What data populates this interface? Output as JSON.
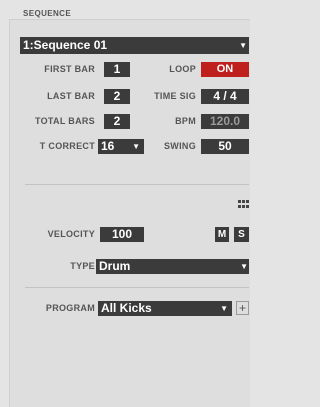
{
  "section": {
    "title": "SEQUENCE"
  },
  "sequence_select": {
    "value": "1:Sequence 01"
  },
  "fields": {
    "first_bar": {
      "label": "FIRST BAR",
      "value": "1"
    },
    "last_bar": {
      "label": "LAST BAR",
      "value": "2"
    },
    "total_bars": {
      "label": "TOTAL BARS",
      "value": "2"
    },
    "t_correct": {
      "label": "T CORRECT",
      "value": "16"
    },
    "loop": {
      "label": "LOOP",
      "value": "ON"
    },
    "time_sig": {
      "label": "TIME SIG",
      "value": "4 / 4"
    },
    "bpm": {
      "label": "BPM",
      "value": "120.0"
    },
    "swing": {
      "label": "SWING",
      "value": "50"
    }
  },
  "track": {
    "velocity": {
      "label": "VELOCITY",
      "value": "100"
    },
    "mute_label": "M",
    "solo_label": "S",
    "type": {
      "label": "TYPE",
      "value": "Drum"
    },
    "program": {
      "label": "PROGRAM",
      "value": "All Kicks"
    },
    "add_label": "+"
  },
  "icons": {
    "dropdown": "chevron-down-icon",
    "grid": "grid-icon"
  },
  "colors": {
    "field_bg": "#3b3b3b",
    "loop_on": "#c0201d",
    "panel_bg": "#dedede"
  }
}
